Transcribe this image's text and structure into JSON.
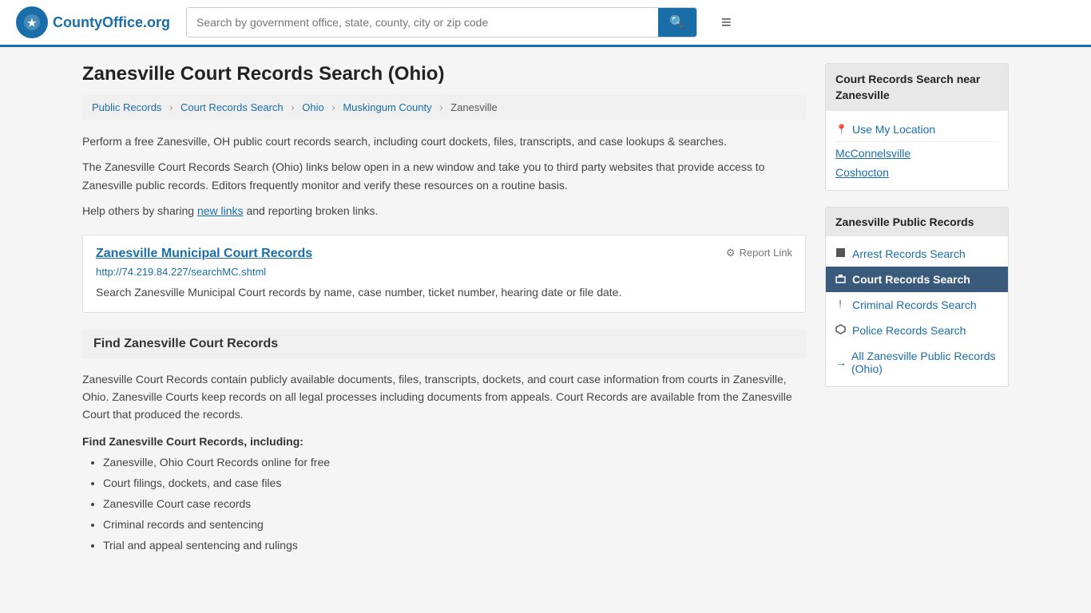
{
  "header": {
    "logo_text": "CountyOffice",
    "logo_suffix": ".org",
    "search_placeholder": "Search by government office, state, county, city or zip code"
  },
  "page": {
    "title": "Zanesville Court Records Search (Ohio)"
  },
  "breadcrumb": {
    "items": [
      {
        "label": "Public Records",
        "href": "#"
      },
      {
        "label": "Court Records Search",
        "href": "#"
      },
      {
        "label": "Ohio",
        "href": "#"
      },
      {
        "label": "Muskingum County",
        "href": "#"
      },
      {
        "label": "Zanesville",
        "href": "#"
      }
    ]
  },
  "description": {
    "para1": "Perform a free Zanesville, OH public court records search, including court dockets, files, transcripts, and case lookups & searches.",
    "para2": "The Zanesville Court Records Search (Ohio) links below open in a new window and take you to third party websites that provide access to Zanesville public records. Editors frequently monitor and verify these resources on a routine basis.",
    "para3_prefix": "Help others by sharing ",
    "para3_link": "new links",
    "para3_suffix": " and reporting broken links."
  },
  "record_card": {
    "title": "Zanesville Municipal Court Records",
    "url": "http://74.219.84.227/searchMC.shtml",
    "description": "Search Zanesville Municipal Court records by name, case number, ticket number, hearing date or file date.",
    "report_label": "Report Link"
  },
  "find_section": {
    "title": "Find Zanesville Court Records",
    "description": "Zanesville Court Records contain publicly available documents, files, transcripts, dockets, and court case information from courts in Zanesville, Ohio. Zanesville Courts keep records on all legal processes including documents from appeals. Court Records are available from the Zanesville Court that produced the records.",
    "including_label": "Find Zanesville Court Records, including:",
    "list_items": [
      "Zanesville, Ohio Court Records online for free",
      "Court filings, dockets, and case files",
      "Zanesville Court case records",
      "Criminal records and sentencing",
      "Trial and appeal sentencing and rulings"
    ]
  },
  "sidebar": {
    "nearby_title": "Court Records Search near Zanesville",
    "use_my_location": "Use My Location",
    "nearby_links": [
      {
        "label": "McConnelsville",
        "href": "#"
      },
      {
        "label": "Coshocton",
        "href": "#"
      }
    ],
    "public_records_title": "Zanesville Public Records",
    "public_items": [
      {
        "label": "Arrest Records Search",
        "icon": "■",
        "active": false
      },
      {
        "label": "Court Records Search",
        "icon": "▪",
        "active": true
      },
      {
        "label": "Criminal Records Search",
        "icon": "!",
        "active": false
      },
      {
        "label": "Police Records Search",
        "icon": "◈",
        "active": false
      }
    ],
    "all_records_label": "All Zanesville Public Records (Ohio)"
  }
}
